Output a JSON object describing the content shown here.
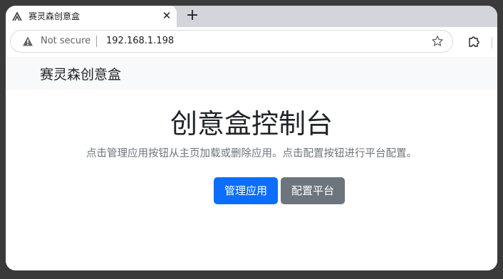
{
  "browser": {
    "tab_title": "赛灵森创意盒",
    "tab_close": "✕",
    "new_tab": "+",
    "security_label": "Not secure",
    "url": "192.168.1.198"
  },
  "page": {
    "brand": "赛灵森创意盒",
    "headline": "创意盒控制台",
    "lead": "点击管理应用按钮从主页加载或删除应用。点击配置按钮进行平台配置。",
    "buttons": {
      "manage": "管理应用",
      "configure": "配置平台"
    }
  },
  "colors": {
    "primary": "#0d6efd",
    "secondary": "#6c757d",
    "navbar_bg": "#f8f9fa"
  },
  "icons": {
    "favicon": "logo-icon",
    "security": "warning-triangle-icon",
    "bookmark": "star-icon",
    "extensions": "puzzle-icon"
  }
}
